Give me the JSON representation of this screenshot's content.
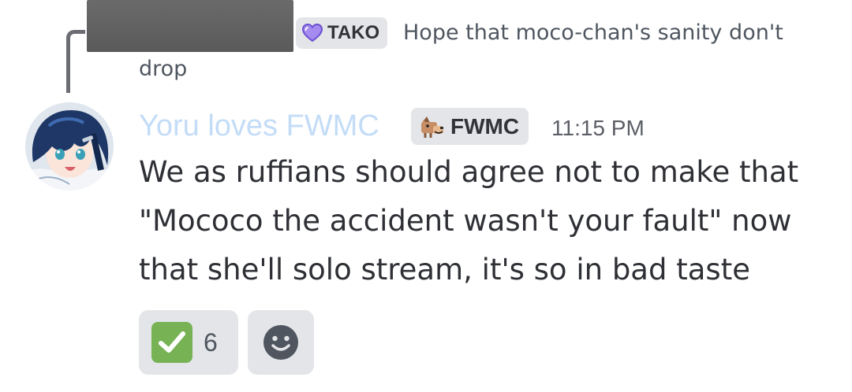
{
  "reply": {
    "author_tag": "TAKO",
    "text_line1": "Hope that moco-chan's sanity don't",
    "text_line2": "drop"
  },
  "message": {
    "username": "Yoru loves FWMC",
    "username_color": "#c3dcf7",
    "role_tag": "FWMC",
    "timestamp": "11:15 PM",
    "lines": [
      "We as ruffians should agree not to make that",
      "\"Mococo the accident wasn't your fault\" now",
      "that she'll solo stream, it's so in bad taste"
    ]
  },
  "reactions": [
    {
      "icon": "check-mark-icon",
      "color": "#77b255",
      "count": "6"
    },
    {
      "icon": "add-reaction-icon"
    }
  ]
}
